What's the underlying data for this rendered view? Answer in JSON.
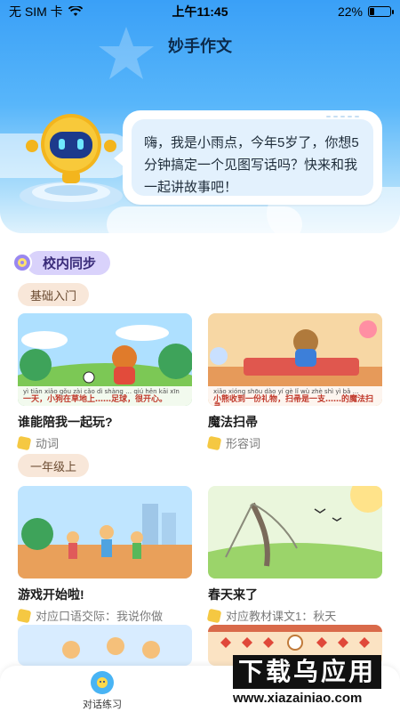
{
  "status": {
    "carrier": "无 SIM 卡",
    "time": "上午11:45",
    "battery": "22%",
    "battery_level": 0.22
  },
  "header": {
    "title": "妙手作文"
  },
  "speech": {
    "text": "嗨，我是小雨点，今年5岁了，你想5分钟搞定一个见图写话吗？快来和我一起讲故事吧！"
  },
  "section": {
    "label": "校内同步"
  },
  "groups": [
    {
      "label": "基础入门",
      "cards": [
        {
          "title": "谁能陪我一起玩?",
          "sub": "动词",
          "caption_pinyin": "yì tiān  xiǎo gǒu zài cǎo dì shàng  … qiú hěn kāi xīn",
          "caption": "一天，小狗在草地上……足球，很开心。"
        },
        {
          "title": "魔法扫帚",
          "sub": "形容词",
          "caption_pinyin": "xiǎo xióng shōu dào yí gè lǐ wù  zhè shì yì bǎ …",
          "caption": "小熊收到一份礼物，扫帚是一支……的魔法扫帚"
        }
      ]
    },
    {
      "label": "一年级上",
      "cards": [
        {
          "title": "游戏开始啦!",
          "sub": "对应口语交际：我说你做"
        },
        {
          "title": "春天来了",
          "sub": "对应教材课文1：秋天"
        }
      ]
    }
  ],
  "tabbar": {
    "tab1": "对话练习"
  },
  "watermark": {
    "line1": "下载乌应用",
    "url": "www.xiazainiao.com"
  },
  "colors": {
    "accent": "#3aa0f7",
    "section": "#d9d2fb",
    "chip": "#f8e7d9"
  }
}
